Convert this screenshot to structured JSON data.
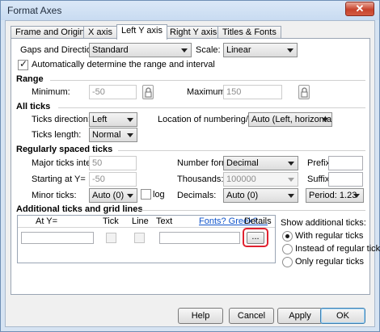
{
  "window": {
    "title": "Format Axes",
    "close_glyph": "✕"
  },
  "tabs": [
    "Frame and Origin",
    "X axis",
    "Left Y axis",
    "Right Y axis",
    "Titles & Fonts"
  ],
  "active_tab": "Left Y axis",
  "gaps": {
    "label": "Gaps and Direction:",
    "value": "Standard",
    "scale_label": "Scale:",
    "scale_value": "Linear",
    "auto_label": "Automatically determine the range and interval",
    "auto_checked": true
  },
  "range": {
    "heading": "Range",
    "min_label": "Minimum:",
    "min_value": "-50",
    "max_label": "Maximum:",
    "max_value": "150"
  },
  "all_ticks": {
    "heading": "All ticks",
    "direction_label": "Ticks direction:",
    "direction_value": "Left",
    "length_label": "Ticks length:",
    "length_value": "Normal",
    "location_label": "Location of numbering/labeling:",
    "location_value": "Auto (Left, horizontal)"
  },
  "regular": {
    "heading": "Regularly spaced ticks",
    "major_label": "Major ticks interval:",
    "major_value": "50",
    "start_label": "Starting at Y=",
    "start_value": "-50",
    "minor_label": "Minor ticks:",
    "minor_value": "Auto (0)",
    "log_label": "log",
    "numfmt_label": "Number format:",
    "numfmt_value": "Decimal",
    "thousands_label": "Thousands:",
    "thousands_value": "100000",
    "decimals_label": "Decimals:",
    "decimals_value": "Auto (0)",
    "prefix_label": "Prefix:",
    "prefix_value": "",
    "suffix_label": "Suffix:",
    "suffix_value": "",
    "period_value": "Period: 1.23"
  },
  "additional": {
    "heading": "Additional ticks and grid lines",
    "columns": [
      "At Y=",
      "Tick",
      "Line",
      "Text",
      "Fonts? Greek?....",
      "Details"
    ],
    "details_button": "...",
    "show_label": "Show additional ticks:",
    "options": [
      "With regular ticks",
      "Instead of regular ticks",
      "Only regular ticks"
    ],
    "selected_option": "With regular ticks"
  },
  "buttons": {
    "help": "Help",
    "cancel": "Cancel",
    "apply": "Apply",
    "ok": "OK"
  }
}
